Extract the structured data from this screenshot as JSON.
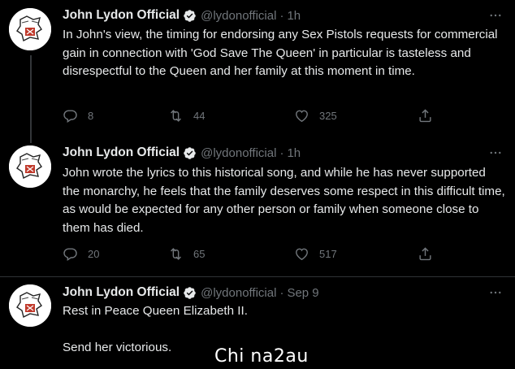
{
  "author": {
    "name": "John Lydon Official",
    "handle": "@lydonofficial",
    "avatar_icon": "sex-pistols-logo-avatar",
    "verified_icon": "verified-badge-icon"
  },
  "separator": "·",
  "tweets": [
    {
      "time": "1h",
      "text": "In John's view, the timing for endorsing any Sex Pistols requests for commercial gain in connection with 'God Save The Queen' in particular is tasteless and disrespectful to the Queen and her family at this moment in time.",
      "replies": "8",
      "retweets": "44",
      "likes": "325"
    },
    {
      "time": "1h",
      "text": "John wrote the lyrics to this historical song, and while he has never supported the monarchy, he feels that the family deserves some respect in this difficult time, as would be expected for any other person or family when someone close to them has died.",
      "replies": "20",
      "retweets": "65",
      "likes": "517"
    },
    {
      "time": "Sep 9",
      "text": "Rest in Peace Queen Elizabeth II.\n\nSend her victorious."
    }
  ],
  "watermark": "Chi na2au",
  "colors": {
    "background": "#000000",
    "text": "#e7e9ea",
    "secondary": "#71767b",
    "verified": "#1d9bf0",
    "thread_line": "#333639"
  }
}
